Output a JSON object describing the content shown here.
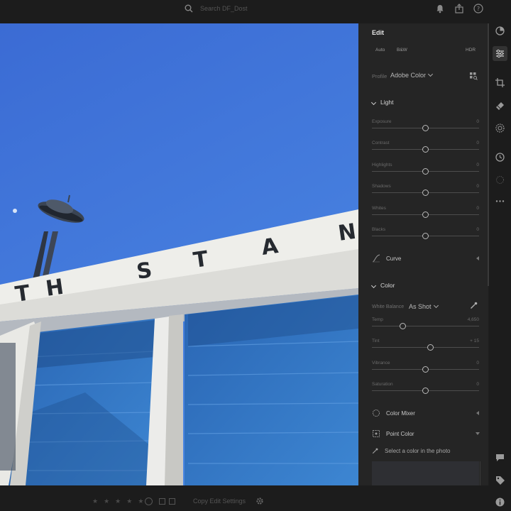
{
  "topbar": {
    "search_placeholder": "Search DF_Dost",
    "icons": [
      "search-icon",
      "bell-icon",
      "share-icon",
      "help-icon",
      "cloud-icon"
    ]
  },
  "bottombar": {
    "rating_stars": [
      "★",
      "★",
      "★",
      "★",
      "★"
    ],
    "copy_label": "Copy Edit Settings",
    "icons": [
      "flag-circle-icon",
      "flag-pick-icon",
      "flag-reject-icon",
      "gear-icon"
    ]
  },
  "panel": {
    "title": "Edit",
    "quick_buttons": [
      "Auto",
      "B&W",
      "HDR"
    ],
    "profile": {
      "label": "Profile",
      "value": "Adobe Color"
    },
    "light": {
      "title": "Light",
      "sliders": [
        {
          "label": "Exposure",
          "value": "0",
          "position": 0.5
        },
        {
          "label": "Contrast",
          "value": "0",
          "position": 0.5
        },
        {
          "label": "Highlights",
          "value": "0",
          "position": 0.5
        },
        {
          "label": "Shadows",
          "value": "0",
          "position": 0.5
        },
        {
          "label": "Whites",
          "value": "0",
          "position": 0.5
        },
        {
          "label": "Blacks",
          "value": "0",
          "position": 0.5
        }
      ]
    },
    "curve": {
      "title": "Curve"
    },
    "color": {
      "title": "Color",
      "white_balance": {
        "label": "White Balance",
        "value": "As Shot"
      },
      "sliders": [
        {
          "label": "Temp",
          "value": "4,650",
          "position": 0.29
        },
        {
          "label": "Tint",
          "value": "+ 15",
          "position": 0.545
        },
        {
          "label": "Vibrance",
          "value": "0",
          "position": 0.5
        },
        {
          "label": "Saturation",
          "value": "0",
          "position": 0.5
        }
      ]
    },
    "color_mixer": {
      "title": "Color Mixer"
    },
    "point_color": {
      "title": "Point Color",
      "hint": "Select a color in the photo"
    }
  },
  "toolbar": {
    "tools": [
      "presets-icon",
      "edit-sliders-icon",
      "crop-icon",
      "healing-icon",
      "masking-icon",
      "versions-icon",
      "ai-icon",
      "more-icon",
      "comment-icon",
      "tag-icon",
      "info-icon"
    ]
  },
  "photo": {
    "sign_letters": [
      "T",
      "H",
      "S",
      "T",
      "A",
      "N"
    ],
    "colors": {
      "sky": "#3a6fd8",
      "building": "#f0f0ec",
      "doors": "#2f74c2"
    }
  }
}
